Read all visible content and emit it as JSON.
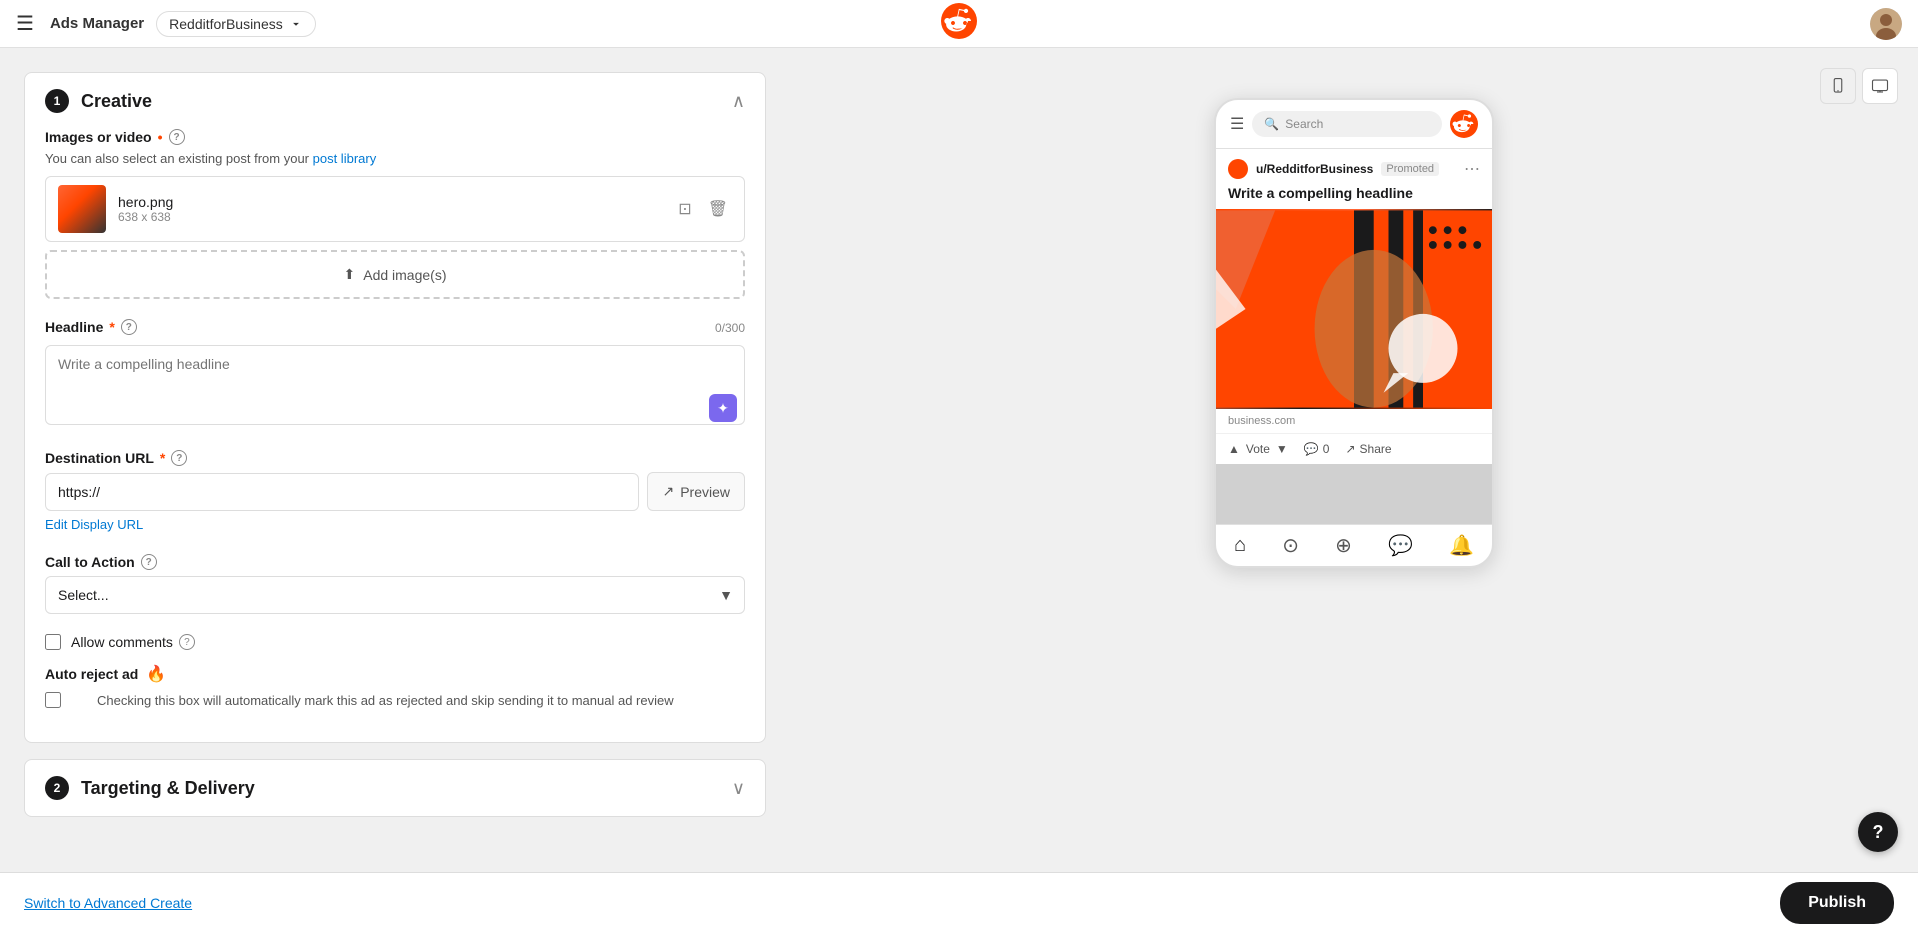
{
  "nav": {
    "menu_label": "☰",
    "ads_manager": "Ads Manager",
    "brand": "RedditforBusiness",
    "reddit_logo_color": "#ff4500"
  },
  "preview": {
    "mobile_icon": "📱",
    "desktop_icon": "🖥"
  },
  "creative_section": {
    "number": "1",
    "title": "Creative",
    "images_label": "Images or video",
    "images_sublabel": "You can also select an existing post from your",
    "post_library_link": "post library",
    "image": {
      "name": "hero.png",
      "dimensions": "638 x 638"
    },
    "add_images_label": "Add image(s)",
    "headline_label": "Headline",
    "headline_placeholder": "Write a compelling headline",
    "headline_char_count": "0/300",
    "destination_url_label": "Destination URL",
    "destination_url_value": "https://",
    "preview_btn": "Preview",
    "edit_display_url": "Edit Display URL",
    "call_to_action_label": "Call to Action",
    "call_to_action_placeholder": "Select...",
    "allow_comments_label": "Allow comments",
    "auto_reject_label": "Auto reject ad",
    "auto_reject_desc": "Checking this box will automatically mark this ad as rejected and skip sending it to manual ad review"
  },
  "targeting_section": {
    "number": "2",
    "title": "Targeting & Delivery"
  },
  "phone_preview": {
    "search_placeholder": "Search",
    "author": "u/RedditforBusiness",
    "promoted": "Promoted",
    "post_title": "Write a compelling headline",
    "domain": "business.com",
    "vote_label": "Vote",
    "comments_count": "0",
    "share_label": "Share"
  },
  "bottom": {
    "switch_link": "Switch to Advanced Create",
    "publish_label": "Publish"
  },
  "help": "?"
}
